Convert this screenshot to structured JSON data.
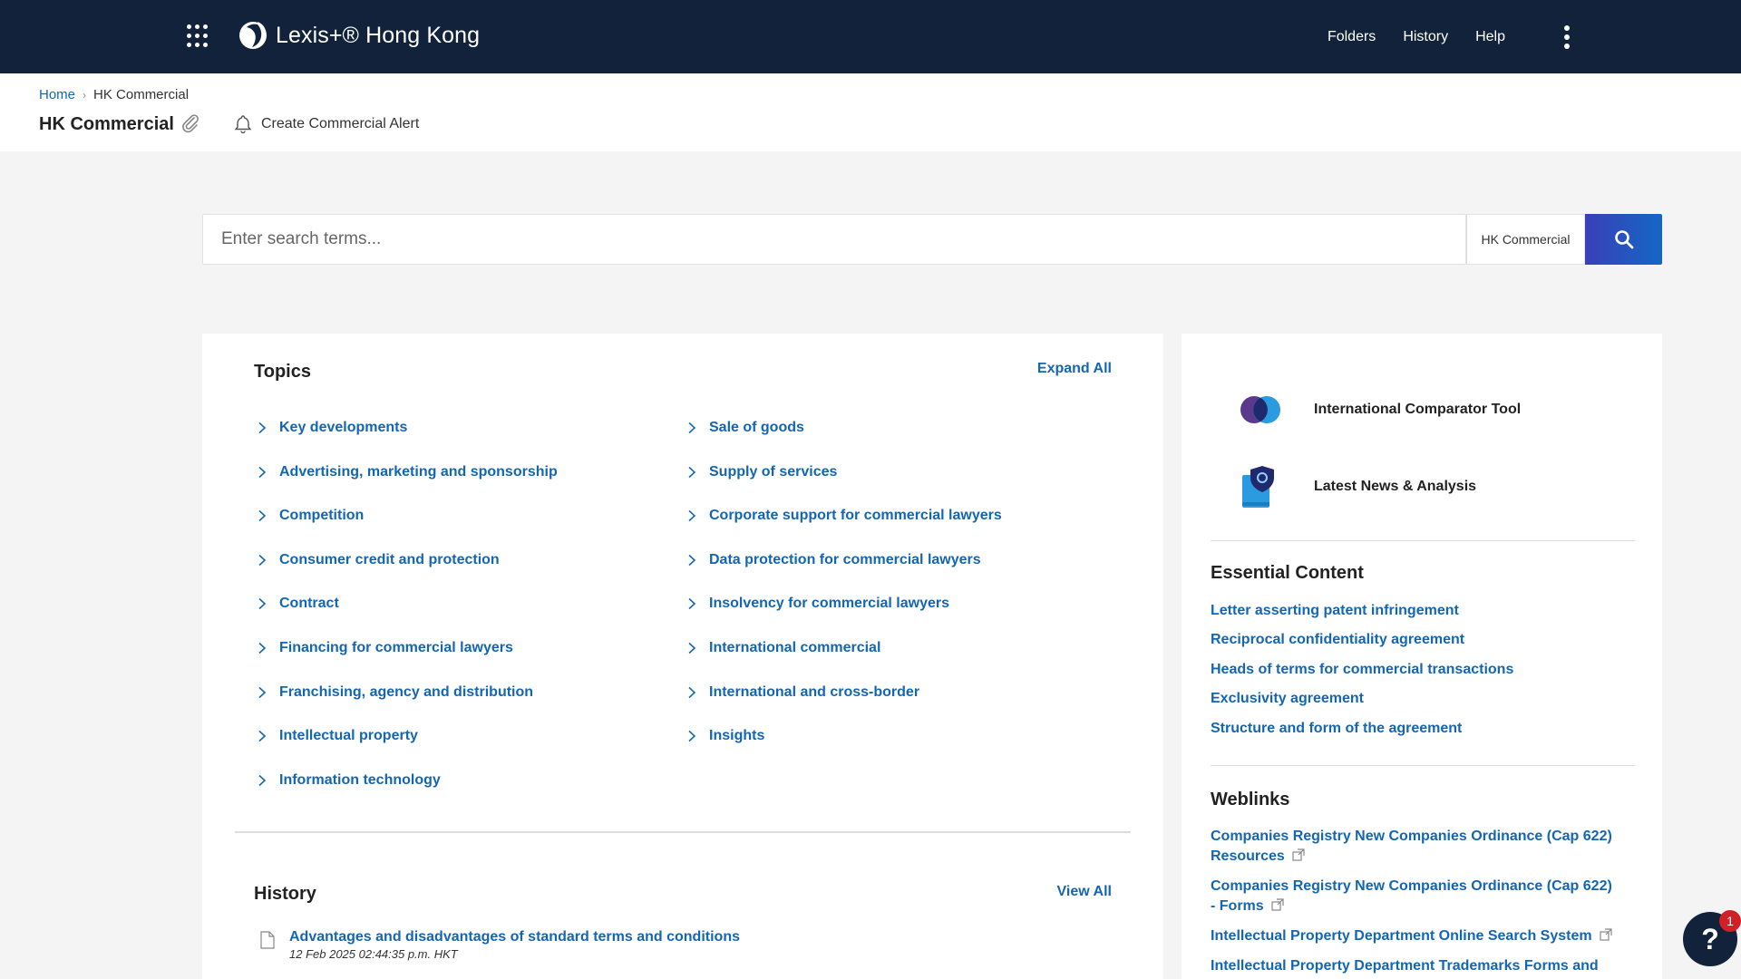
{
  "app": {
    "brand": "Lexis+® Hong Kong",
    "brand_text": "Lexis+",
    "brand_region": "Hong Kong"
  },
  "nav": {
    "links": [
      {
        "label": "Folders"
      },
      {
        "label": "History"
      },
      {
        "label": "Help"
      }
    ]
  },
  "breadcrumb": {
    "home": "Home",
    "current": "HK Commercial"
  },
  "page": {
    "title": "HK Commercial",
    "alert_label": "Create Commercial Alert"
  },
  "search": {
    "placeholder": "Enter search terms...",
    "scope": "HK Commercial"
  },
  "topics": {
    "title": "Topics",
    "expand_label": "Expand All",
    "left": [
      {
        "label": "Key developments"
      },
      {
        "label": "Advertising, marketing and sponsorship"
      },
      {
        "label": "Competition"
      },
      {
        "label": "Consumer credit and protection"
      },
      {
        "label": "Contract"
      },
      {
        "label": "Financing for commercial lawyers"
      },
      {
        "label": "Franchising, agency and distribution"
      },
      {
        "label": "Intellectual property"
      },
      {
        "label": "Information technology"
      }
    ],
    "right": [
      {
        "label": "Sale of goods"
      },
      {
        "label": "Supply of services"
      },
      {
        "label": "Corporate support for commercial lawyers"
      },
      {
        "label": "Data protection for commercial lawyers"
      },
      {
        "label": "Insolvency for commercial lawyers"
      },
      {
        "label": "International commercial"
      },
      {
        "label": "International and cross-border"
      },
      {
        "label": "Insights"
      }
    ]
  },
  "history": {
    "title": "History",
    "view_all_label": "View All",
    "items": [
      {
        "title": "Advantages and disadvantages of standard terms and conditions",
        "date": "12 Feb 2025 02:44:35 p.m. HKT"
      }
    ]
  },
  "tools": [
    {
      "label": "International Comparator Tool",
      "icon": "comparator-icon"
    },
    {
      "label": "Latest News & Analysis",
      "icon": "news-shield-icon"
    }
  ],
  "essential_content": {
    "title": "Essential Content",
    "links": [
      "Letter asserting patent infringement",
      "Reciprocal confidentiality agreement",
      "Heads of terms for commercial transactions",
      "Exclusivity agreement",
      "Structure and form of the agreement"
    ]
  },
  "weblinks": {
    "title": "Weblinks",
    "links": [
      "Companies Registry New Companies Ordinance (Cap 622) Resources",
      "Companies Registry New Companies Ordinance (Cap 622) - Forms",
      "Intellectual Property Department Online Search System",
      "Intellectual Property Department Trademarks Forms and"
    ]
  },
  "help": {
    "label": "?",
    "badge": "1"
  },
  "colors": {
    "nav_bg": "#12223a",
    "link": "#1466b2",
    "page_bg": "#f4f4f5",
    "badge": "#d11f27"
  }
}
